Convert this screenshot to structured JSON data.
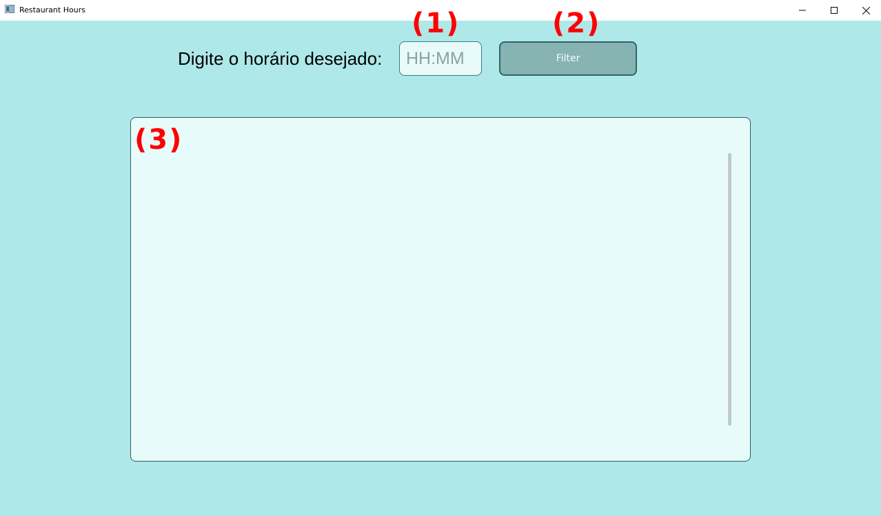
{
  "window": {
    "title": "Restaurant Hours",
    "controls": [
      "minimize-icon",
      "maximize-icon",
      "close-icon"
    ]
  },
  "form": {
    "label": "Digite o horário desejado:",
    "time_input": {
      "value": "",
      "placeholder": "HH:MM"
    },
    "filter_button_label": "Filter"
  },
  "results": {
    "items": []
  },
  "annotations": {
    "one": "(1)",
    "two": "(2)",
    "three": "(3)"
  },
  "colors": {
    "background": "#aee8e8",
    "panel": "#e8fbfb",
    "button": "#87b3b3",
    "annotation": "#ff0000"
  }
}
